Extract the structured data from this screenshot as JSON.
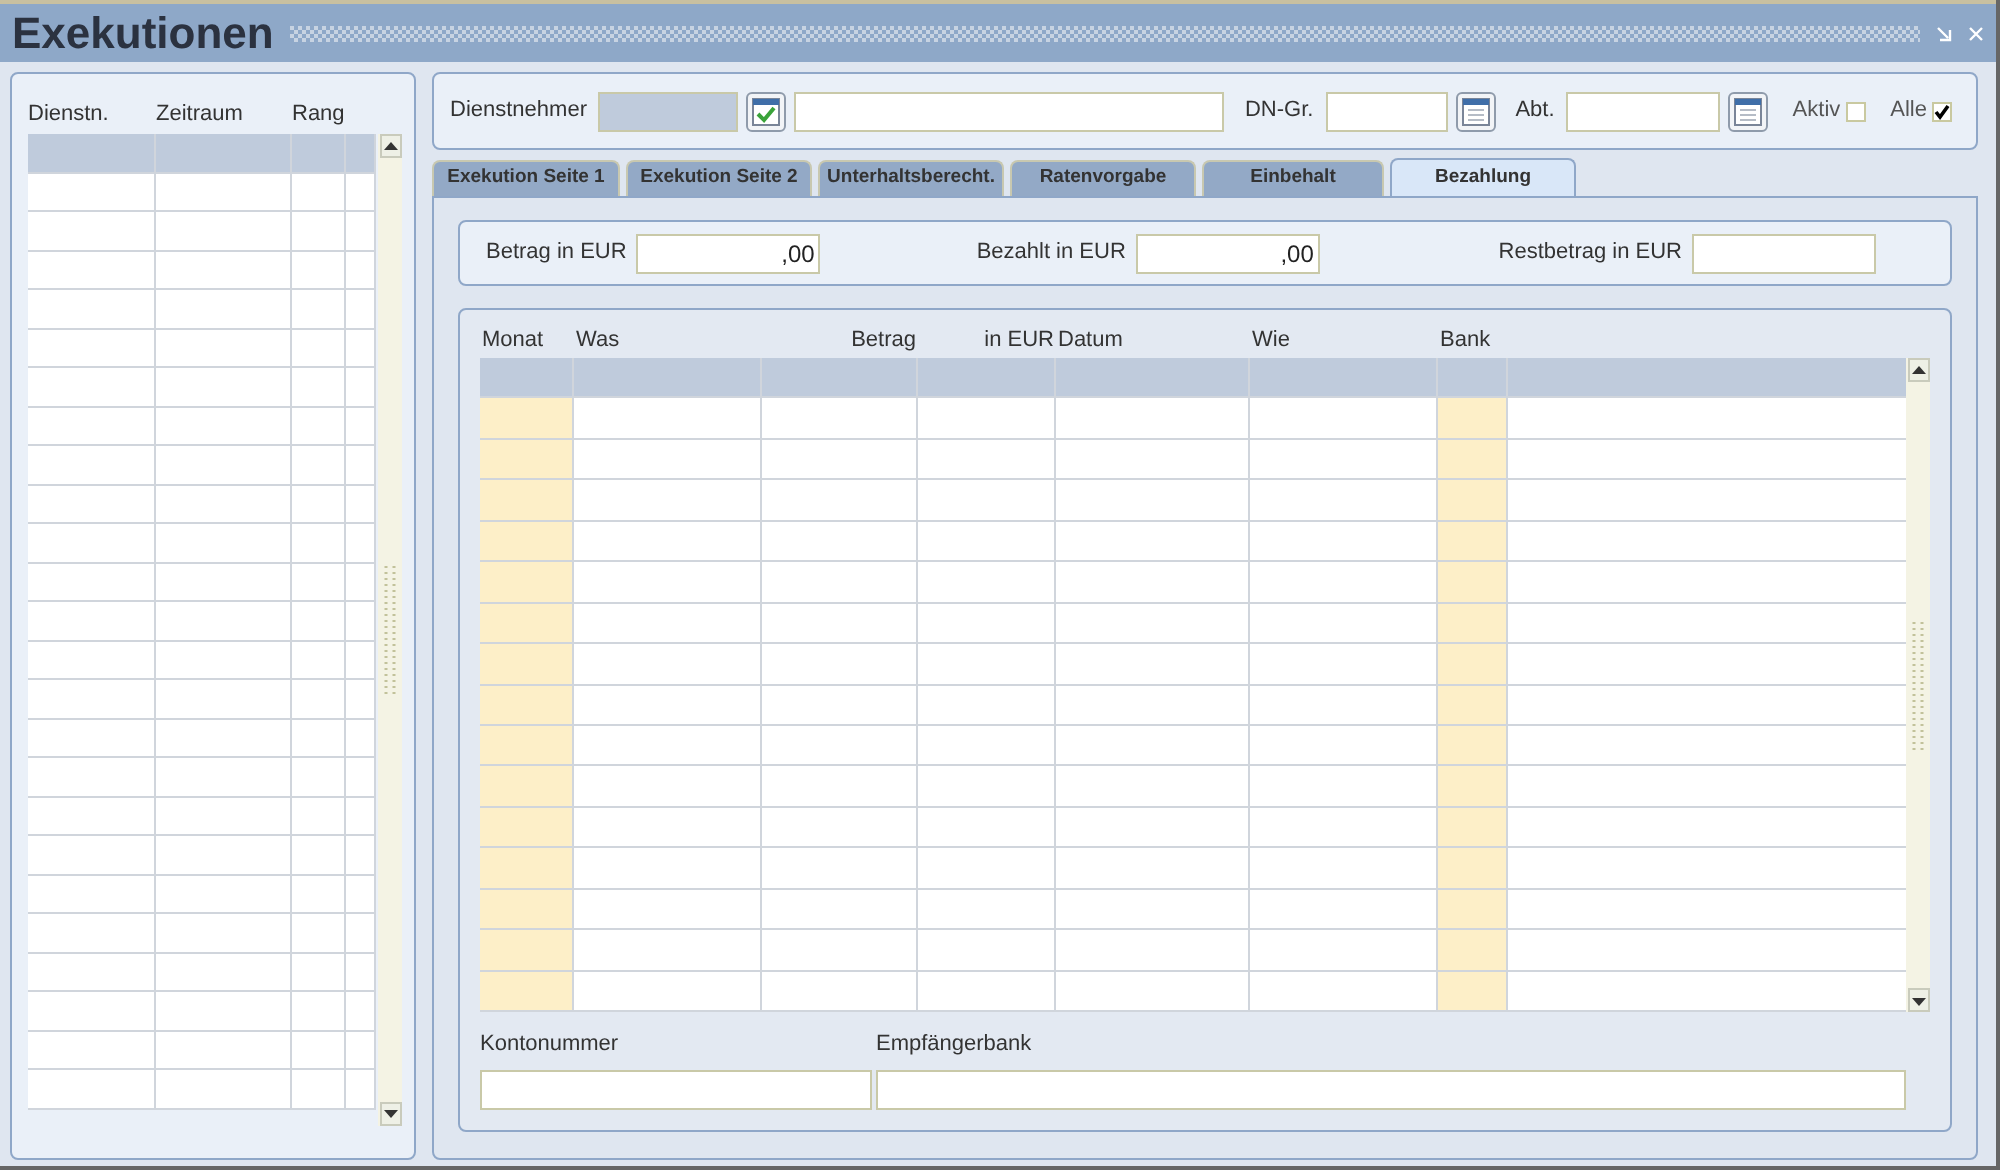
{
  "window": {
    "title": "Exekutionen"
  },
  "list_table": {
    "columns": [
      "Dienstn.",
      "Zeitraum",
      "Rang"
    ]
  },
  "filter": {
    "employee_label": "Dienstnehmer",
    "group_label": "DN-Gr.",
    "department_label": "Abt.",
    "checkboxes": [
      {
        "label": "Aktiv",
        "checked": false
      },
      {
        "label": "Alle",
        "checked": true
      }
    ]
  },
  "tabs": [
    {
      "label": "Exekution Seite 1",
      "selected": false
    },
    {
      "label": "Exekution Seite 2",
      "selected": false
    },
    {
      "label": "Unterhaltsberecht.",
      "selected": false
    },
    {
      "label": "Ratenvorgabe",
      "selected": false
    },
    {
      "label": "Einbehalt",
      "selected": false
    },
    {
      "label": "Bezahlung",
      "selected": true
    }
  ],
  "amounts": [
    {
      "label": "Betrag in EUR",
      "value": ",00"
    },
    {
      "label": "Bezahlt in EUR",
      "value": ",00"
    },
    {
      "label": "Restbetrag in EUR"
    }
  ],
  "payments_table": {
    "columns": [
      {
        "label": "Monat",
        "highlighted": true
      },
      {
        "label": "Was",
        "highlighted": false
      },
      {
        "label": "Betrag",
        "highlighted": false
      },
      {
        "label": "in EUR",
        "highlighted": false
      },
      {
        "label": "Datum",
        "highlighted": false
      },
      {
        "label": "Wie",
        "highlighted": false
      },
      {
        "label": "Bank",
        "highlighted": true
      }
    ]
  },
  "bank": {
    "account_label": "Kontonummer",
    "bank_label": "Empfängerbank"
  }
}
